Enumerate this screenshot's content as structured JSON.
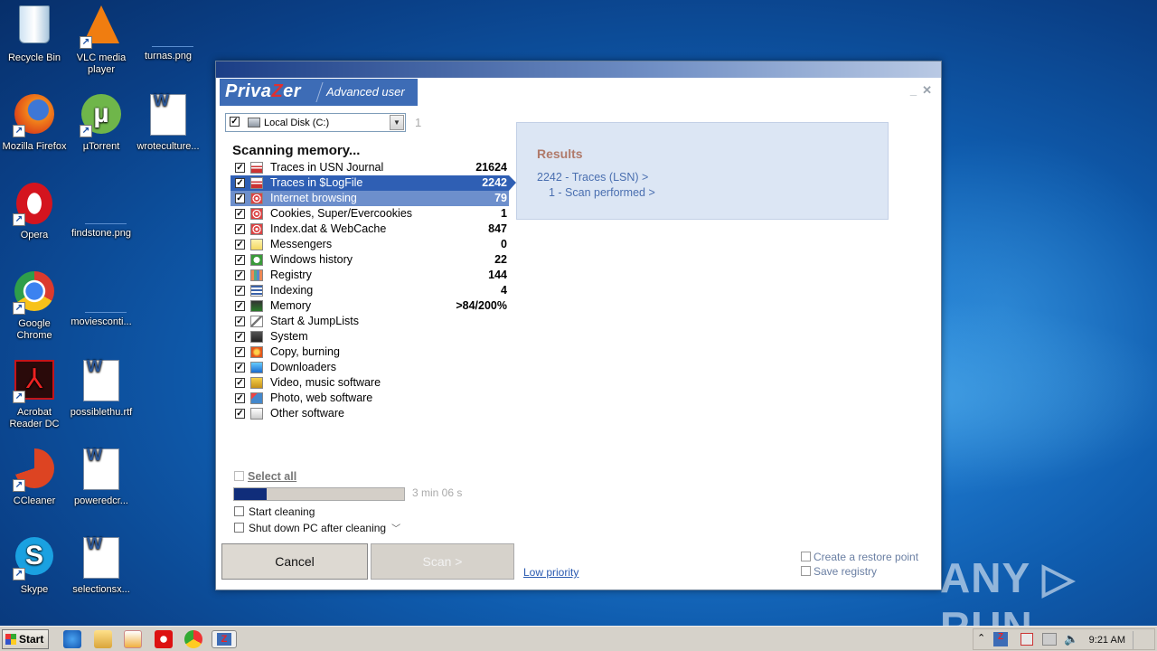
{
  "desktop": {
    "icons": [
      {
        "id": "recycle",
        "label": "Recycle Bin"
      },
      {
        "id": "vlc",
        "label": "VLC media player"
      },
      {
        "id": "turnas",
        "label": "turnas.png"
      },
      {
        "id": "firefox",
        "label": "Mozilla Firefox"
      },
      {
        "id": "utorrent",
        "label": "µTorrent"
      },
      {
        "id": "wrote",
        "label": "wroteculture..."
      },
      {
        "id": "opera",
        "label": "Opera"
      },
      {
        "id": "findstone",
        "label": "findstone.png"
      },
      {
        "id": "chrome",
        "label": "Google Chrome"
      },
      {
        "id": "movies",
        "label": "moviesconti..."
      },
      {
        "id": "acrobat",
        "label": "Acrobat Reader DC"
      },
      {
        "id": "possible",
        "label": "possiblethu.rtf"
      },
      {
        "id": "ccleaner",
        "label": "CCleaner"
      },
      {
        "id": "powered",
        "label": "poweredcr..."
      },
      {
        "id": "skype",
        "label": "Skype"
      },
      {
        "id": "selection",
        "label": "selectionsx..."
      }
    ]
  },
  "window": {
    "logo_pre": "Priva",
    "logo_z": "Z",
    "logo_post": "er",
    "mode": "Advanced user",
    "minimize": "_",
    "close": "✕",
    "disk_label": "Local Disk (C:)",
    "disk_index": "1",
    "scan_title": "Scanning memory...",
    "items": [
      {
        "label": "Traces in USN Journal",
        "value": "21624",
        "icon": "usn-journal-icon",
        "state": ""
      },
      {
        "label": "Traces in $LogFile",
        "value": "2242",
        "icon": "logfile-icon",
        "state": "sel"
      },
      {
        "label": "Internet browsing",
        "value": "79",
        "icon": "internet-browsing-icon",
        "state": "sel2"
      },
      {
        "label": "Cookies, Super/Evercookies",
        "value": "1",
        "icon": "cookies-icon",
        "state": ""
      },
      {
        "label": "Index.dat & WebCache",
        "value": "847",
        "icon": "index-dat-icon",
        "state": ""
      },
      {
        "label": "Messengers",
        "value": "0",
        "icon": "messengers-icon",
        "state": ""
      },
      {
        "label": "Windows history",
        "value": "22",
        "icon": "windows-history-icon",
        "state": ""
      },
      {
        "label": "Registry",
        "value": "144",
        "icon": "registry-icon",
        "state": ""
      },
      {
        "label": "Indexing",
        "value": "4",
        "icon": "indexing-icon",
        "state": ""
      },
      {
        "label": "Memory",
        "value": ">84/200%",
        "icon": "memory-icon",
        "state": ""
      },
      {
        "label": "Start & JumpLists",
        "value": "",
        "icon": "jumplists-icon",
        "state": ""
      },
      {
        "label": "System",
        "value": "",
        "icon": "system-icon",
        "state": ""
      },
      {
        "label": "Copy, burning",
        "value": "",
        "icon": "burning-icon",
        "state": ""
      },
      {
        "label": "Downloaders",
        "value": "",
        "icon": "downloaders-icon",
        "state": ""
      },
      {
        "label": "Video, music software",
        "value": "",
        "icon": "video-music-icon",
        "state": ""
      },
      {
        "label": "Photo, web software",
        "value": "",
        "icon": "photo-web-icon",
        "state": ""
      },
      {
        "label": "Other software",
        "value": "",
        "icon": "other-software-icon",
        "state": ""
      }
    ],
    "results": {
      "title": "Results",
      "line1": "2242 - Traces (LSN) >",
      "line2": "1 - Scan performed >"
    },
    "select_all": "Select all",
    "progress_fraction": 0.19,
    "progress_time": "3 min 06 s",
    "start_cleaning": "Start cleaning",
    "shutdown": "Shut down PC after cleaning",
    "cancel": "Cancel",
    "scan": "Scan >",
    "low_priority": "Low priority",
    "restore_point": "Create a restore point",
    "save_registry": "Save registry"
  },
  "watermark": "ANY ▷ RUN",
  "taskbar": {
    "start": "Start",
    "clock": "9:21 AM"
  },
  "colors": {
    "selection": "#2f5fb4",
    "selection_light": "#6d8fcc",
    "results_bg": "#dce6f4",
    "progress_fill": "#102d7a"
  }
}
